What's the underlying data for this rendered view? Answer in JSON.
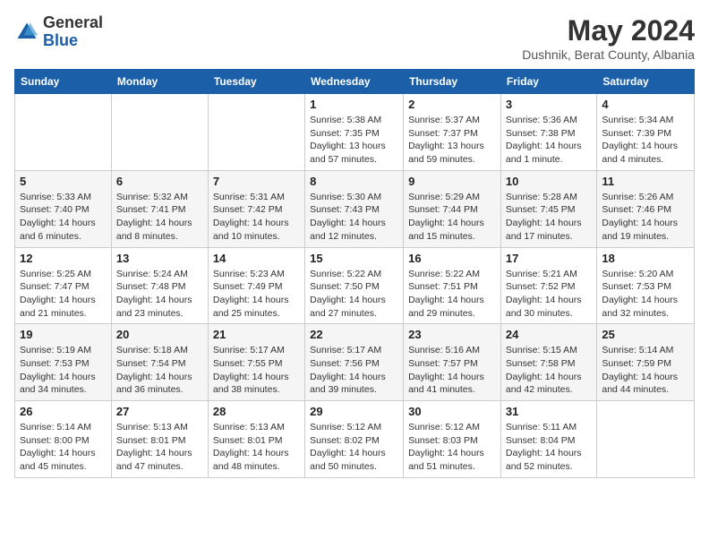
{
  "header": {
    "logo_general": "General",
    "logo_blue": "Blue",
    "month_title": "May 2024",
    "location": "Dushnik, Berat County, Albania"
  },
  "days_of_week": [
    "Sunday",
    "Monday",
    "Tuesday",
    "Wednesday",
    "Thursday",
    "Friday",
    "Saturday"
  ],
  "weeks": [
    [
      {
        "num": "",
        "sunrise": "",
        "sunset": "",
        "daylight": ""
      },
      {
        "num": "",
        "sunrise": "",
        "sunset": "",
        "daylight": ""
      },
      {
        "num": "",
        "sunrise": "",
        "sunset": "",
        "daylight": ""
      },
      {
        "num": "1",
        "sunrise": "Sunrise: 5:38 AM",
        "sunset": "Sunset: 7:35 PM",
        "daylight": "Daylight: 13 hours and 57 minutes."
      },
      {
        "num": "2",
        "sunrise": "Sunrise: 5:37 AM",
        "sunset": "Sunset: 7:37 PM",
        "daylight": "Daylight: 13 hours and 59 minutes."
      },
      {
        "num": "3",
        "sunrise": "Sunrise: 5:36 AM",
        "sunset": "Sunset: 7:38 PM",
        "daylight": "Daylight: 14 hours and 1 minute."
      },
      {
        "num": "4",
        "sunrise": "Sunrise: 5:34 AM",
        "sunset": "Sunset: 7:39 PM",
        "daylight": "Daylight: 14 hours and 4 minutes."
      }
    ],
    [
      {
        "num": "5",
        "sunrise": "Sunrise: 5:33 AM",
        "sunset": "Sunset: 7:40 PM",
        "daylight": "Daylight: 14 hours and 6 minutes."
      },
      {
        "num": "6",
        "sunrise": "Sunrise: 5:32 AM",
        "sunset": "Sunset: 7:41 PM",
        "daylight": "Daylight: 14 hours and 8 minutes."
      },
      {
        "num": "7",
        "sunrise": "Sunrise: 5:31 AM",
        "sunset": "Sunset: 7:42 PM",
        "daylight": "Daylight: 14 hours and 10 minutes."
      },
      {
        "num": "8",
        "sunrise": "Sunrise: 5:30 AM",
        "sunset": "Sunset: 7:43 PM",
        "daylight": "Daylight: 14 hours and 12 minutes."
      },
      {
        "num": "9",
        "sunrise": "Sunrise: 5:29 AM",
        "sunset": "Sunset: 7:44 PM",
        "daylight": "Daylight: 14 hours and 15 minutes."
      },
      {
        "num": "10",
        "sunrise": "Sunrise: 5:28 AM",
        "sunset": "Sunset: 7:45 PM",
        "daylight": "Daylight: 14 hours and 17 minutes."
      },
      {
        "num": "11",
        "sunrise": "Sunrise: 5:26 AM",
        "sunset": "Sunset: 7:46 PM",
        "daylight": "Daylight: 14 hours and 19 minutes."
      }
    ],
    [
      {
        "num": "12",
        "sunrise": "Sunrise: 5:25 AM",
        "sunset": "Sunset: 7:47 PM",
        "daylight": "Daylight: 14 hours and 21 minutes."
      },
      {
        "num": "13",
        "sunrise": "Sunrise: 5:24 AM",
        "sunset": "Sunset: 7:48 PM",
        "daylight": "Daylight: 14 hours and 23 minutes."
      },
      {
        "num": "14",
        "sunrise": "Sunrise: 5:23 AM",
        "sunset": "Sunset: 7:49 PM",
        "daylight": "Daylight: 14 hours and 25 minutes."
      },
      {
        "num": "15",
        "sunrise": "Sunrise: 5:22 AM",
        "sunset": "Sunset: 7:50 PM",
        "daylight": "Daylight: 14 hours and 27 minutes."
      },
      {
        "num": "16",
        "sunrise": "Sunrise: 5:22 AM",
        "sunset": "Sunset: 7:51 PM",
        "daylight": "Daylight: 14 hours and 29 minutes."
      },
      {
        "num": "17",
        "sunrise": "Sunrise: 5:21 AM",
        "sunset": "Sunset: 7:52 PM",
        "daylight": "Daylight: 14 hours and 30 minutes."
      },
      {
        "num": "18",
        "sunrise": "Sunrise: 5:20 AM",
        "sunset": "Sunset: 7:53 PM",
        "daylight": "Daylight: 14 hours and 32 minutes."
      }
    ],
    [
      {
        "num": "19",
        "sunrise": "Sunrise: 5:19 AM",
        "sunset": "Sunset: 7:53 PM",
        "daylight": "Daylight: 14 hours and 34 minutes."
      },
      {
        "num": "20",
        "sunrise": "Sunrise: 5:18 AM",
        "sunset": "Sunset: 7:54 PM",
        "daylight": "Daylight: 14 hours and 36 minutes."
      },
      {
        "num": "21",
        "sunrise": "Sunrise: 5:17 AM",
        "sunset": "Sunset: 7:55 PM",
        "daylight": "Daylight: 14 hours and 38 minutes."
      },
      {
        "num": "22",
        "sunrise": "Sunrise: 5:17 AM",
        "sunset": "Sunset: 7:56 PM",
        "daylight": "Daylight: 14 hours and 39 minutes."
      },
      {
        "num": "23",
        "sunrise": "Sunrise: 5:16 AM",
        "sunset": "Sunset: 7:57 PM",
        "daylight": "Daylight: 14 hours and 41 minutes."
      },
      {
        "num": "24",
        "sunrise": "Sunrise: 5:15 AM",
        "sunset": "Sunset: 7:58 PM",
        "daylight": "Daylight: 14 hours and 42 minutes."
      },
      {
        "num": "25",
        "sunrise": "Sunrise: 5:14 AM",
        "sunset": "Sunset: 7:59 PM",
        "daylight": "Daylight: 14 hours and 44 minutes."
      }
    ],
    [
      {
        "num": "26",
        "sunrise": "Sunrise: 5:14 AM",
        "sunset": "Sunset: 8:00 PM",
        "daylight": "Daylight: 14 hours and 45 minutes."
      },
      {
        "num": "27",
        "sunrise": "Sunrise: 5:13 AM",
        "sunset": "Sunset: 8:01 PM",
        "daylight": "Daylight: 14 hours and 47 minutes."
      },
      {
        "num": "28",
        "sunrise": "Sunrise: 5:13 AM",
        "sunset": "Sunset: 8:01 PM",
        "daylight": "Daylight: 14 hours and 48 minutes."
      },
      {
        "num": "29",
        "sunrise": "Sunrise: 5:12 AM",
        "sunset": "Sunset: 8:02 PM",
        "daylight": "Daylight: 14 hours and 50 minutes."
      },
      {
        "num": "30",
        "sunrise": "Sunrise: 5:12 AM",
        "sunset": "Sunset: 8:03 PM",
        "daylight": "Daylight: 14 hours and 51 minutes."
      },
      {
        "num": "31",
        "sunrise": "Sunrise: 5:11 AM",
        "sunset": "Sunset: 8:04 PM",
        "daylight": "Daylight: 14 hours and 52 minutes."
      },
      {
        "num": "",
        "sunrise": "",
        "sunset": "",
        "daylight": ""
      }
    ]
  ]
}
